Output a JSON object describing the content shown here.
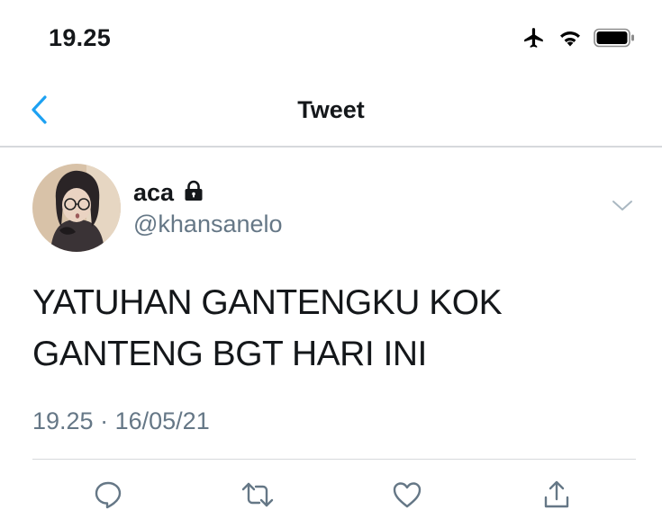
{
  "status_bar": {
    "time": "19.25",
    "icons": [
      "airplane-icon",
      "wifi-icon",
      "battery-icon"
    ]
  },
  "nav": {
    "title": "Tweet",
    "back_icon": "chevron-left-icon"
  },
  "tweet": {
    "display_name": "aca",
    "protected_icon": "lock-icon",
    "handle": "@khansanelo",
    "text_lines": [
      "YATUHAN GANTENGKU KOK",
      "GANTENG BGT HARI INI"
    ],
    "time": "19.25",
    "separator": "·",
    "date": "16/05/21",
    "menu_icon": "chevron-down-icon"
  },
  "actions": [
    "reply-icon",
    "retweet-icon",
    "like-icon",
    "share-icon"
  ],
  "colors": {
    "accent": "#1da1f2",
    "secondary_text": "#657786",
    "divider": "#d6d9dc",
    "text": "#14171a"
  }
}
